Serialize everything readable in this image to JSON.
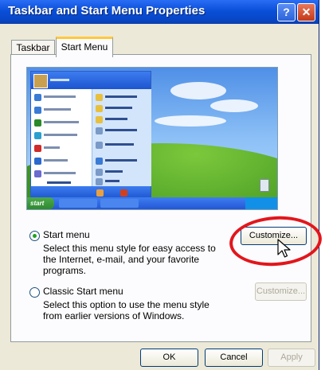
{
  "window": {
    "title": "Taskbar and Start Menu Properties",
    "help_glyph": "?",
    "close_glyph": "✕"
  },
  "tabs": [
    {
      "label": "Taskbar",
      "active": false
    },
    {
      "label": "Start Menu",
      "active": true
    }
  ],
  "preview": {
    "start_label": "start"
  },
  "options": {
    "start_menu": {
      "label": "Start menu",
      "description": "Select this menu style for easy access to the Internet, e-mail, and your favorite programs.",
      "selected": true,
      "customize_label": "Customize...",
      "customize_enabled": true
    },
    "classic_menu": {
      "label": "Classic Start menu",
      "description": "Select this option to use the menu style from earlier versions of Windows.",
      "selected": false,
      "customize_label": "Customize...",
      "customize_enabled": false
    }
  },
  "footer": {
    "ok_label": "OK",
    "cancel_label": "Cancel",
    "apply_label": "Apply"
  },
  "colors": {
    "titlebar": "#0a4fd8",
    "dialog_bg": "#ece9d8",
    "annotation_circle": "#e2161c"
  }
}
